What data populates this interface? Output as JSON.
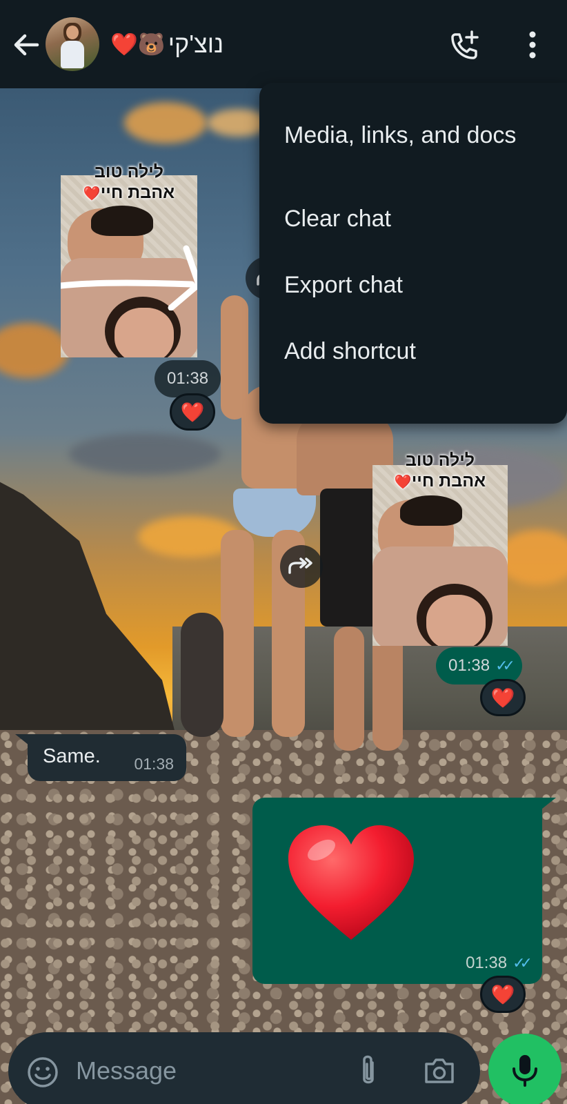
{
  "header": {
    "contact_name": "נוצ'קי",
    "contact_emoji": "❤️🐻"
  },
  "menu": {
    "items": [
      {
        "label": "Media, links, and docs"
      },
      {
        "label": "Clear chat"
      },
      {
        "label": "Export chat"
      },
      {
        "label": "Add shortcut"
      }
    ]
  },
  "messages": [
    {
      "type": "image",
      "direction": "incoming",
      "caption_line1": "לילה טוב",
      "caption_line2": "אהבת חיי",
      "caption_emoji": "❤️",
      "time": "01:38",
      "reaction": "❤️"
    },
    {
      "type": "image",
      "direction": "outgoing",
      "caption_line1": "לילה טוב",
      "caption_line2": "אהבת חיי",
      "caption_emoji": "❤️",
      "time": "01:38",
      "ticks": "✓✓",
      "reaction": "❤️"
    },
    {
      "type": "text",
      "direction": "incoming",
      "text": "Same.",
      "time": "01:38"
    },
    {
      "type": "emoji",
      "direction": "outgoing",
      "emoji": "❤️",
      "time": "01:38",
      "ticks": "✓✓",
      "reaction": "❤️"
    }
  ],
  "composer": {
    "placeholder": "Message"
  },
  "colors": {
    "header_bg": "#111b21",
    "incoming_bubble": "#202c33",
    "outgoing_bubble": "#005c4b",
    "read_ticks": "#53bdeb",
    "mic_button": "#21c063"
  }
}
